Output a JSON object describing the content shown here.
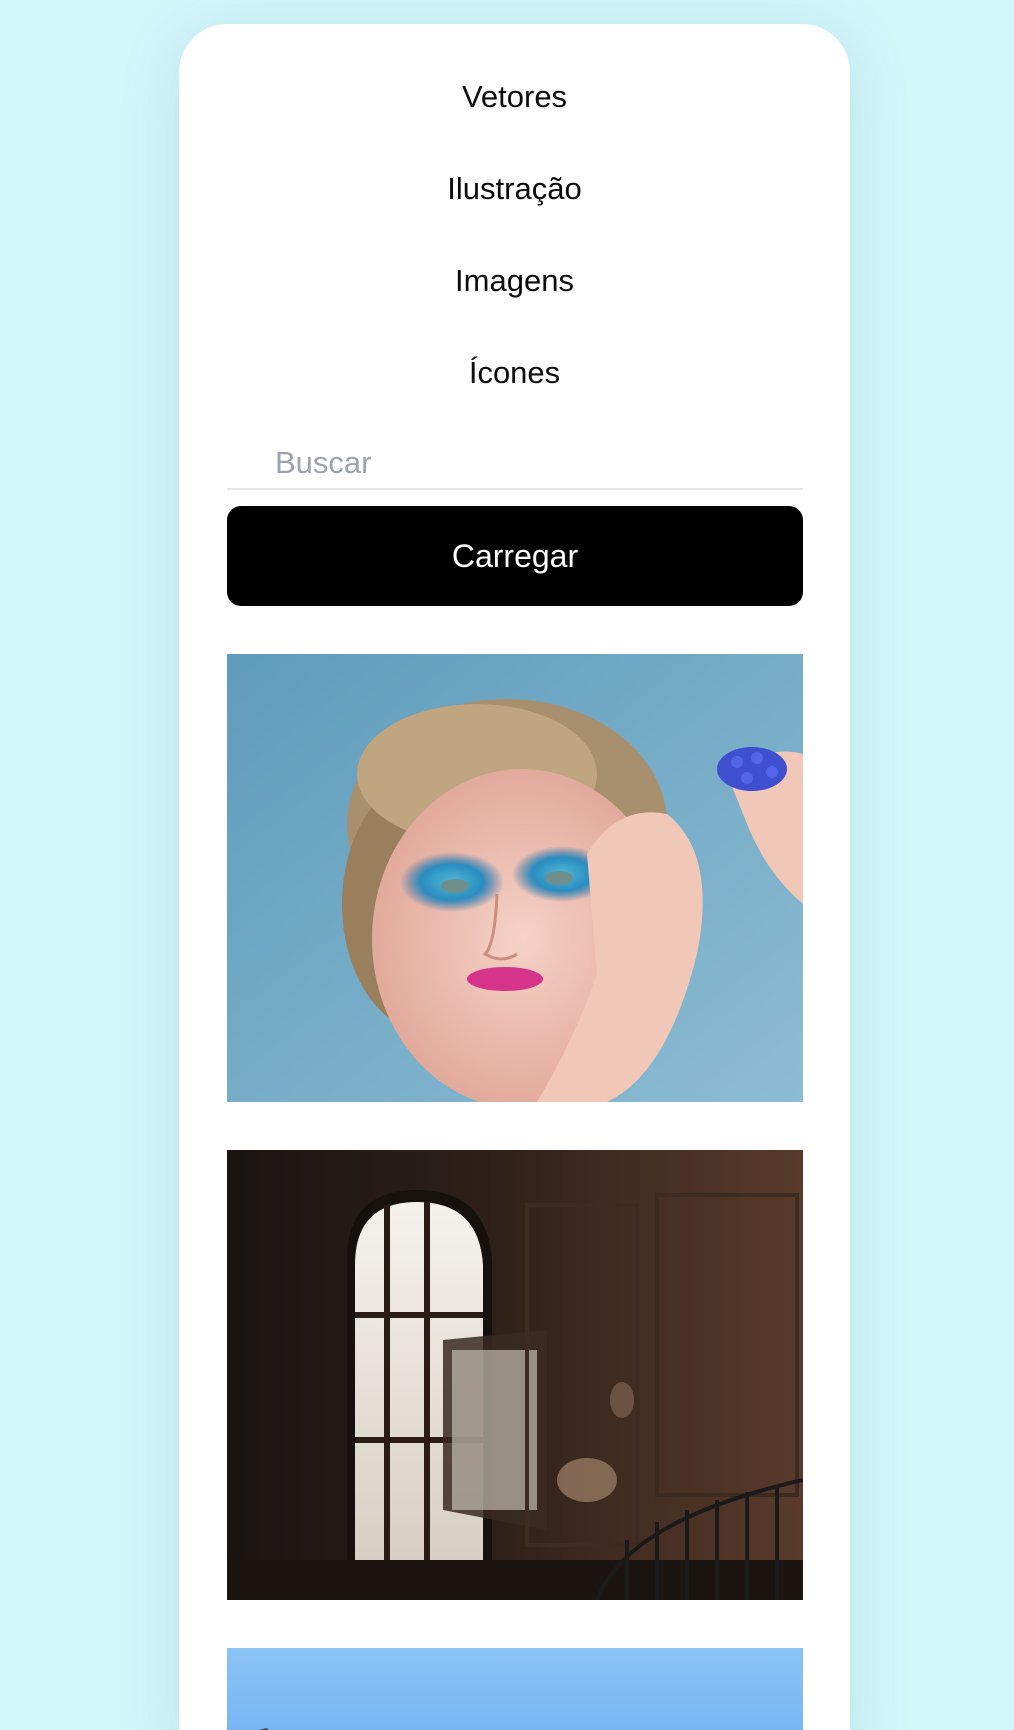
{
  "nav": {
    "items": [
      {
        "label": "Vetores"
      },
      {
        "label": "Ilustração"
      },
      {
        "label": "Imagens"
      },
      {
        "label": "Ícones"
      }
    ]
  },
  "search": {
    "placeholder": "Buscar",
    "value": ""
  },
  "load_button": {
    "label": "Carregar"
  },
  "gallery": {
    "images": [
      {
        "subject": "portrait-with-blue-eyeshadow"
      },
      {
        "subject": "abandoned-room-with-arched-window"
      },
      {
        "subject": "blue-sky"
      }
    ]
  },
  "colors": {
    "background": "#d3f6fb",
    "card": "#ffffff",
    "button": "#000000",
    "button_text": "#ffffff",
    "placeholder": "#9ca3af"
  }
}
